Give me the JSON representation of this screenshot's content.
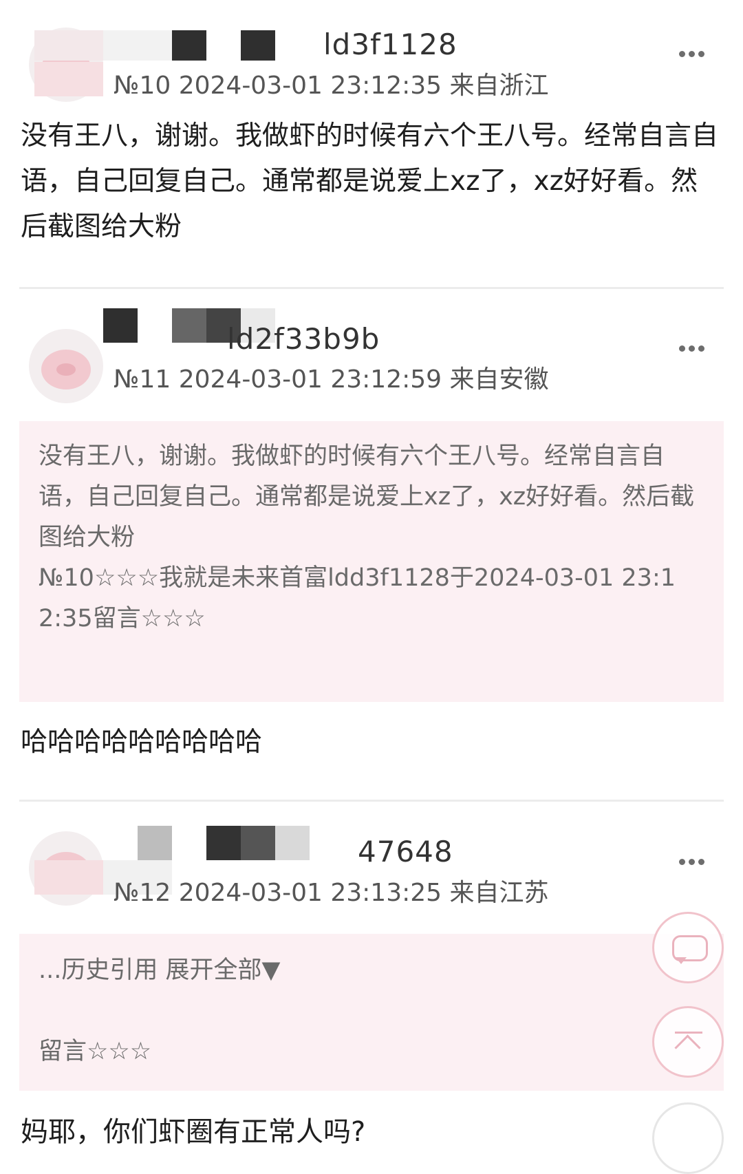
{
  "posts": [
    {
      "username": "ld3f1128",
      "floor": "№10",
      "datetime": "2024-03-01 23:12:35",
      "location": "来自浙江",
      "content": "没有王八，谢谢。我做虾的时候有六个王八号。经常自言自语，自己回复自己。通常都是说爱上xz了，xz好好看。然后截图给大粉",
      "more_icon": "more-icon"
    },
    {
      "username": "ld2f33b9b",
      "floor": "№11",
      "datetime": "2024-03-01 23:12:59",
      "location": "来自安徽",
      "quote": {
        "text": "没有王八，谢谢。我做虾的时候有六个王八号。经常自言自语，自己回复自己。通常都是说爱上xz了，xz好好看。然后截图给大粉",
        "meta": "№10☆☆☆我就是未来首富ldd3f1128于2024-03-01 23:12:35留言☆☆☆"
      },
      "content": "哈哈哈哈哈哈哈哈哈"
    },
    {
      "username": "47648",
      "floor": "№12",
      "datetime": "2024-03-01 23:13:25",
      "location": "来自江苏",
      "quote": {
        "history": "...历史引用 展开全部▼",
        "meta": "留言☆☆☆"
      },
      "content": "妈耶，你们虾圈有正常人吗?"
    }
  ],
  "fabs": {
    "comment_icon": "comment-icon",
    "top_icon": "back-to-top-icon"
  }
}
